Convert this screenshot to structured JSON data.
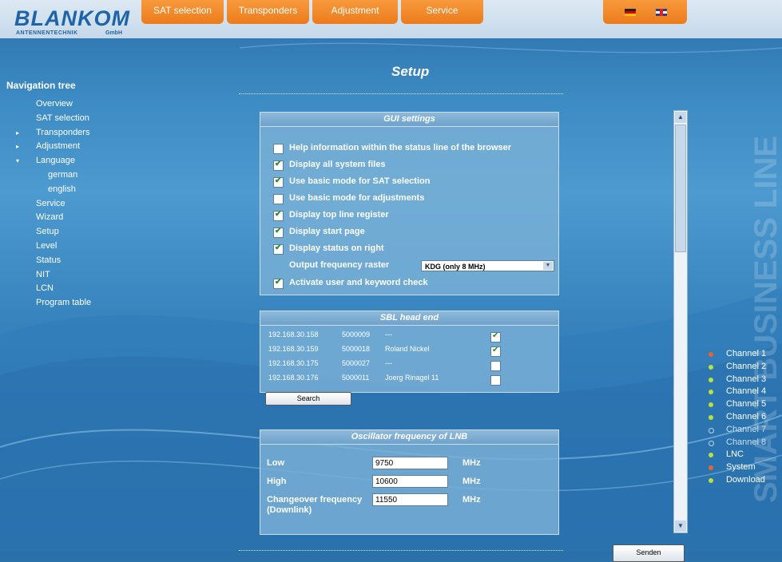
{
  "brand": {
    "name": "BLANKOM",
    "sub": "ANTENNENTECHNIK",
    "gmbh": "GmbH"
  },
  "top_tabs": [
    {
      "label": "SAT selection"
    },
    {
      "label": "Transponders"
    },
    {
      "label": "Adjustment"
    },
    {
      "label": "Service"
    }
  ],
  "page_title": "Setup",
  "nav": {
    "title": "Navigation tree",
    "items": [
      {
        "label": "Overview",
        "arrow": ""
      },
      {
        "label": "SAT selection",
        "arrow": ""
      },
      {
        "label": "Transponders",
        "arrow": "▸"
      },
      {
        "label": "Adjustment",
        "arrow": "▸"
      },
      {
        "label": "Language",
        "arrow": "▾"
      },
      {
        "label": "german",
        "arrow": ""
      },
      {
        "label": "english",
        "arrow": ""
      },
      {
        "label": "Service",
        "arrow": ""
      },
      {
        "label": "Wizard",
        "arrow": ""
      },
      {
        "label": "Setup",
        "arrow": ""
      },
      {
        "label": "Level",
        "arrow": ""
      },
      {
        "label": "Status",
        "arrow": ""
      },
      {
        "label": "NIT",
        "arrow": ""
      },
      {
        "label": "LCN",
        "arrow": ""
      },
      {
        "label": "Program table",
        "arrow": ""
      }
    ]
  },
  "gui_settings": {
    "title": "GUI settings",
    "options": [
      {
        "label": "Help information within the status line of the browser",
        "checked": false
      },
      {
        "label": "Display all system files",
        "checked": true
      },
      {
        "label": "Use basic mode for SAT selection",
        "checked": true
      },
      {
        "label": "Use basic mode for adjustments",
        "checked": false
      },
      {
        "label": "Display top line register",
        "checked": true
      },
      {
        "label": "Display start page",
        "checked": true
      },
      {
        "label": "Display status on right",
        "checked": true
      }
    ],
    "raster_label": "Output frequency raster",
    "raster_value": "KDG (only 8 MHz)",
    "activate_label": "Activate user and keyword check",
    "activate_checked": true
  },
  "sbl": {
    "title": "SBL head end",
    "rows": [
      {
        "ip": "192.168.30.158",
        "id": "5000009",
        "name": "---",
        "checked": true
      },
      {
        "ip": "192.168.30.159",
        "id": "5000018",
        "name": "Roland Nickel",
        "checked": true
      },
      {
        "ip": "192.168.30.175",
        "id": "5000027",
        "name": "---",
        "checked": false
      },
      {
        "ip": "192.168.30.176",
        "id": "5000011",
        "name": "Joerg Rinagel 11",
        "checked": false
      }
    ],
    "search_label": "Search"
  },
  "oscillator": {
    "title": "Oscillator frequency of LNB",
    "rows": [
      {
        "label": "Low",
        "value": "9750",
        "unit": "MHz"
      },
      {
        "label": "High",
        "value": "10600",
        "unit": "MHz"
      },
      {
        "label": "Changeover frequency (Downlink)",
        "value": "11550",
        "unit": "MHz"
      }
    ]
  },
  "channels": [
    {
      "label": "Channel 1",
      "color": "#e8652a"
    },
    {
      "label": "Channel 2",
      "color": "#b8e23a"
    },
    {
      "label": "Channel 3",
      "color": "#b8e23a"
    },
    {
      "label": "Channel 4",
      "color": "#b8e23a"
    },
    {
      "label": "Channel 5",
      "color": "#b8e23a"
    },
    {
      "label": "Channel 6",
      "color": "#b8e23a"
    },
    {
      "label": "Channel 7",
      "color": "none"
    },
    {
      "label": "Channel 8",
      "color": "none"
    },
    {
      "label": "LNC",
      "color": "#b8e23a"
    },
    {
      "label": "System",
      "color": "#e8652a"
    },
    {
      "label": "Download",
      "color": "#b8e23a"
    }
  ],
  "side_text": "SMART BUSINESS LINE",
  "send_label": "Senden"
}
